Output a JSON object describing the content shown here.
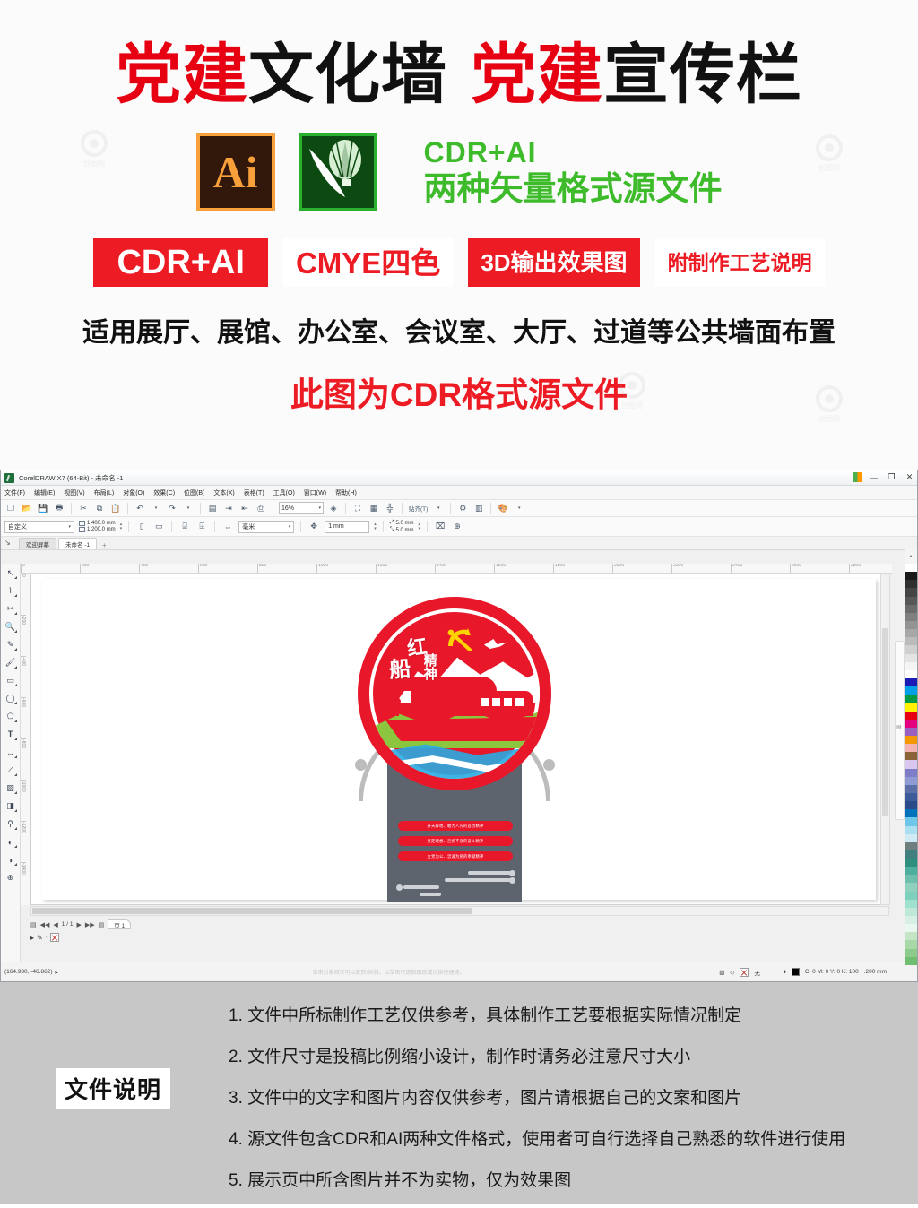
{
  "promo": {
    "title_parts": [
      {
        "text": "党建",
        "color": "red"
      },
      {
        "text": "文化墙",
        "color": "black"
      },
      {
        "text": "党建",
        "color": "red"
      },
      {
        "text": "宣传栏",
        "color": "black"
      }
    ],
    "ai_logo_label": "Ai",
    "cdr_logo_label": "CorelDRAW",
    "caption_line1": "CDR+AI",
    "caption_line2": "两种矢量格式源文件",
    "badges": [
      {
        "label": "CDR+AI",
        "style": "filled"
      },
      {
        "label": "CMYE四色",
        "style": "outline"
      },
      {
        "label": "3D输出效果图",
        "style": "filled"
      },
      {
        "label": "附制作工艺说明",
        "style": "outline"
      }
    ],
    "usage_line": "适用展厅、展馆、办公室、会议室、大厅、过道等公共墙面布置",
    "format_line": "此图为CDR格式源文件",
    "watermark_text": "创图网",
    "watermark_sub": "www.chuangtu.com"
  },
  "coreldraw": {
    "window_title": "CorelDRAW X7 (64-Bit) - 未命名 -1",
    "window_buttons": [
      "—",
      "❐",
      "✕"
    ],
    "menu": [
      "文件(F)",
      "编辑(E)",
      "视图(V)",
      "布局(L)",
      "对象(O)",
      "效果(C)",
      "位图(B)",
      "文本(X)",
      "表格(T)",
      "工具(O)",
      "窗口(W)",
      "帮助(H)"
    ],
    "toolbar": {
      "icons": [
        "新建",
        "打开",
        "保存",
        "打印",
        "剪切",
        "复制",
        "粘贴",
        "撤销",
        "重做",
        "搜索",
        "导入",
        "导出",
        "发布PDF"
      ],
      "zoom_value": "16%",
      "zoom_label": "缩放级别",
      "snap_label": "贴齐(T)",
      "options_label": "选项"
    },
    "propertybar": {
      "page_preset": "自定义",
      "width": "1,400.0 mm",
      "height": "1,200.0 mm",
      "orientation_portrait": "纵向",
      "orientation_landscape": "横向",
      "units_label": "毫米",
      "nudge_value": "1 mm",
      "bleed_top": "5.0 mm",
      "bleed_bottom": "5.0 mm"
    },
    "document_tabs": [
      {
        "label": "欢迎屏幕",
        "active": false
      },
      {
        "label": "未命名 -1",
        "active": true
      }
    ],
    "document_tab_add": "+",
    "toolbox": [
      {
        "name": "pick-tool",
        "glyph": "↖"
      },
      {
        "name": "shape-tool",
        "glyph": "⌇"
      },
      {
        "name": "crop-tool",
        "glyph": "✂"
      },
      {
        "name": "zoom-tool",
        "glyph": "🔍"
      },
      {
        "name": "freehand-tool",
        "glyph": "✎"
      },
      {
        "name": "artistic-media-tool",
        "glyph": "🖌"
      },
      {
        "name": "rectangle-tool",
        "glyph": "▭"
      },
      {
        "name": "ellipse-tool",
        "glyph": "◯"
      },
      {
        "name": "polygon-tool",
        "glyph": "⬠"
      },
      {
        "name": "text-tool",
        "glyph": "A"
      },
      {
        "name": "parallel-dimension-tool",
        "glyph": "↔"
      },
      {
        "name": "straight-line-connector-tool",
        "glyph": "⟋"
      },
      {
        "name": "drop-shadow-tool",
        "glyph": "▧"
      },
      {
        "name": "transparency-tool",
        "glyph": "◨"
      },
      {
        "name": "color-eyedropper-tool",
        "glyph": "⚲"
      },
      {
        "name": "interactive-fill-tool",
        "glyph": "◐"
      },
      {
        "name": "smart-fill-tool",
        "glyph": "◑"
      },
      {
        "name": "quick-customize",
        "glyph": "＋"
      }
    ],
    "ruler_h_ticks": [
      "0",
      "200",
      "400",
      "600",
      "800",
      "1000",
      "1200",
      "1400",
      "1600",
      "1800",
      "2000",
      "2200",
      "2400",
      "2600",
      "2800"
    ],
    "ruler_v_ticks": [
      "0",
      "-200",
      "-400",
      "-600",
      "-800",
      "-1000",
      "-1200",
      "-1400"
    ],
    "page_nav": {
      "first": "◀◀",
      "prev": "◀",
      "counter": "1 / 1",
      "next": "▶",
      "last": "▶▶",
      "add_page": "＋",
      "page_tab": "页 1"
    },
    "statusbar": {
      "coordinates": "(164.930, -46.862)",
      "hint": "单击对象两次可以旋转/倾斜。以单击可选取跟踪或切换快捷键。",
      "outline_label": "无",
      "fill_color": "C: 0 M: 0 Y: 0 K: 100",
      "outline_width": ".200 mm"
    },
    "artwork": {
      "emblem_title_1": "红",
      "emblem_title_2": "船",
      "emblem_title_3": "精神",
      "spirit_lines": [
        "开天辟地、敢为人先的首创精神",
        "坚定理想、百折不挠的奋斗精神",
        "立党为公、忠诚为民的奉献精神"
      ]
    }
  },
  "footer": {
    "label": "文件说明",
    "notes": [
      "1. 文件中所标制作工艺仅供参考，具体制作工艺要根据实际情况制定",
      "2. 文件尺寸是投稿比例缩小设计，制作时请务必注意尺寸大小",
      "3. 文件中的文字和图片内容仅供参考，图片请根据自己的文案和图片",
      "4. 源文件包含CDR和AI两种文件格式，使用者可自行选择自己熟悉的软件进行使用",
      "5. 展示页中所含图片并不为实物，仅为效果图"
    ]
  },
  "colors": {
    "brand_red": "#e60012",
    "badge_red": "#ec1b24",
    "green": "#3dbb2a",
    "footer_bg": "#c7c7c7",
    "emblem_red": "#e8172a",
    "panel_gray": "#5d646e"
  },
  "palette_swatches": [
    "#ffffff",
    "#1a1a1a",
    "#2f2f2f",
    "#444444",
    "#575757",
    "#6b6b6b",
    "#7f7f7f",
    "#939393",
    "#a7a7a7",
    "#bbbbbb",
    "#d0d0d0",
    "#e4e4e4",
    "#f5f5f5",
    "#ffffff",
    "#1b1bb5",
    "#00a0e9",
    "#009944",
    "#fff100",
    "#e60012",
    "#e4007f",
    "#9b5fc0",
    "#f39800",
    "#f5b2b2",
    "#8c6239",
    "#d9c7f0",
    "#7e7ec8",
    "#8e9bd4",
    "#5a6fa8",
    "#3d5a9a",
    "#2b4a8a",
    "#0072bc",
    "#6ec6e8",
    "#a9dff0",
    "#cfeaf5",
    "#6f7f7f",
    "#3f7f7f",
    "#2f8f7f",
    "#4faf9f",
    "#6fbfaf",
    "#8fd0bf",
    "#7fcfbf",
    "#9fe0cf",
    "#bfe8d8",
    "#d8f0e4",
    "#e8f7ef",
    "#c5e6c5",
    "#a8d8a8",
    "#8ccb8c",
    "#70be70"
  ]
}
